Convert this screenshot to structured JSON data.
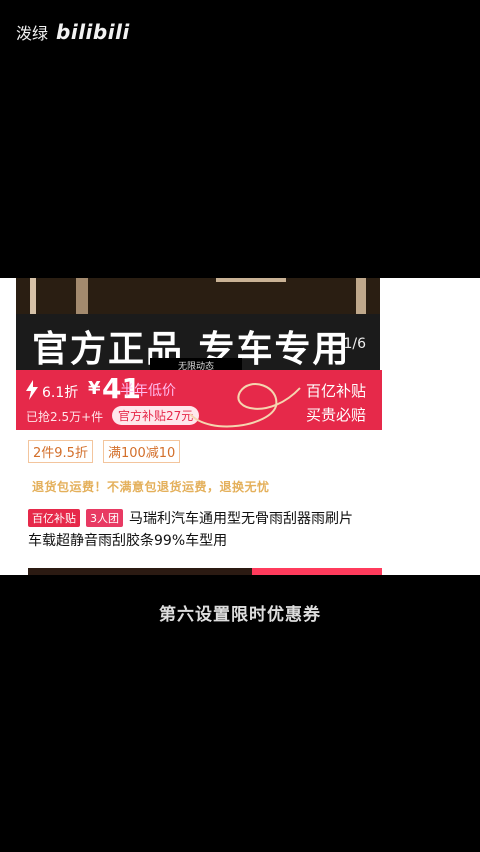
{
  "watermark": {
    "cn": "泼绿",
    "logo": "bilibili"
  },
  "banner": {
    "text": "官方正品 专车专用",
    "index": "1/6",
    "overlay": "无限动态"
  },
  "price": {
    "discount": "6.1折",
    "yen": "¥",
    "amount": "41",
    "note": "半年低价",
    "grabbed": "已抢2.5万+件",
    "official_subsidy": "官方补贴27元",
    "brand_line_1": "百亿补贴",
    "brand_line_2": "买贵必赔"
  },
  "promos": [
    "2件9.5折",
    "满100减10"
  ],
  "shipping": "退货包运费！不满意包退货运费，退换无忧",
  "product": {
    "tag_1": "百亿补贴",
    "tag_2": "3人团",
    "title_1": "马瑞利汽车通用型无骨雨刮器雨刷片",
    "title_2": "车载超静音雨刮胶条99%车型用"
  },
  "subtitle": "第六设置限时优惠券",
  "colors": {
    "accent_red": "#e6294a",
    "background": "#000000",
    "promo_orange": "#d36f2b"
  }
}
